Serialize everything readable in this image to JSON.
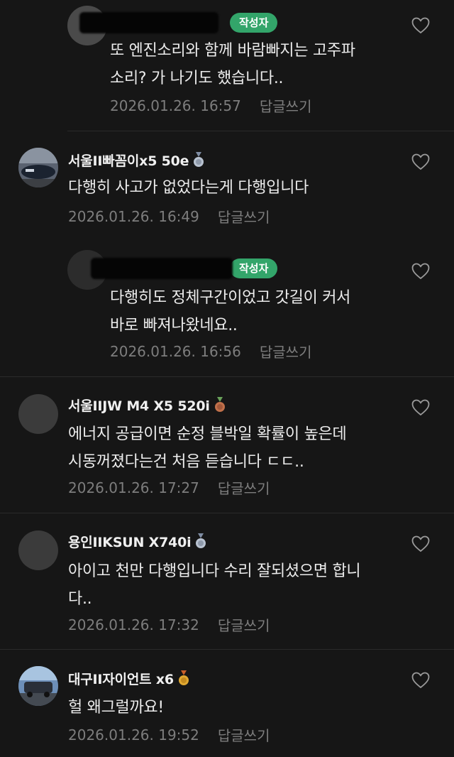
{
  "comments": [
    {
      "author": "",
      "author_badge": "작성자",
      "lines": [
        "또 엔진소리와 함께 바람빠지는 고주파",
        "소리? 가 나기도 했습니다.."
      ],
      "date": "2026.01.26. 16:57",
      "reply_label": "답글쓰기"
    },
    {
      "author": "서울II빠꼼이x5 50e",
      "medal": "silver-medal-icon",
      "lines": [
        "다행히 사고가 없었다는게 다행입니다"
      ],
      "date": "2026.01.26. 16:49",
      "reply_label": "답글쓰기"
    },
    {
      "author": "",
      "author_badge": "작성자",
      "lines": [
        "다행히도 정체구간이었고 갓길이 커서",
        "바로 빠져나왔네요.."
      ],
      "date": "2026.01.26. 16:56",
      "reply_label": "답글쓰기"
    },
    {
      "author": "서울IIJW M4 X5 520i",
      "medal": "bronze-medal-icon",
      "lines": [
        "에너지 공급이면 순정 블박일 확률이 높은데",
        "시동꺼졌다는건 처음 듣습니다 ㄷㄷ.."
      ],
      "date": "2026.01.26. 17:27",
      "reply_label": "답글쓰기"
    },
    {
      "author": "용인IIKSUN X740i",
      "medal": "silver-medal-icon",
      "lines": [
        "아이고 천만 다행입니다 수리 잘되셨으면 합니",
        "다.."
      ],
      "date": "2026.01.26. 17:32",
      "reply_label": "답글쓰기"
    },
    {
      "author": "대구II자이언트 x6",
      "medal": "gold-medal-icon",
      "lines": [
        "헐 왜그럴까요!"
      ],
      "date": "2026.01.26. 19:52",
      "reply_label": "답글쓰기"
    }
  ],
  "colors": {
    "background": "#161616",
    "author_badge": "#33a56a",
    "meta_text": "#7d7d7d",
    "silver_medal": "#b8c2d0",
    "bronze_medal": "#c0704a",
    "gold_medal": "#e0a832"
  }
}
